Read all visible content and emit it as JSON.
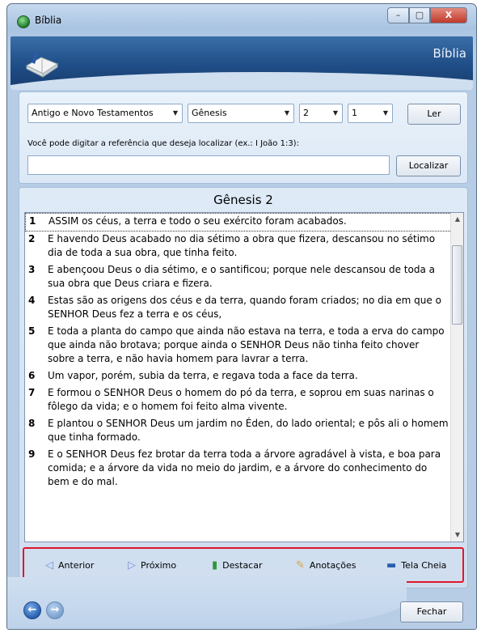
{
  "window": {
    "title": "Bíblia",
    "controls": {
      "minimize": "–",
      "maximize": "▢",
      "close": "X"
    }
  },
  "header": {
    "title": "Bíblia"
  },
  "selectors": {
    "testament": "Antigo e Novo Testamentos",
    "book": "Gênesis",
    "chapter": "2",
    "verse": "1",
    "read_button": "Ler"
  },
  "search": {
    "hint": "Você pode digitar a referência que deseja localizar (ex.: I João 1:3):",
    "value": "",
    "placeholder": "",
    "button": "Localizar"
  },
  "reading": {
    "chapter_title": "Gênesis 2",
    "verses": [
      {
        "num": "1",
        "text": "ASSIM os céus, a terra e todo o seu exército foram acabados."
      },
      {
        "num": "2",
        "text": "E havendo Deus acabado no dia sétimo a obra que fizera, descansou no sétimo dia de toda a sua obra, que tinha feito."
      },
      {
        "num": "3",
        "text": "E abençoou Deus o dia sétimo, e o santificou; porque nele descansou de toda a sua obra que Deus criara e fizera."
      },
      {
        "num": "4",
        "text": "Estas são as origens dos céus e da terra, quando foram criados; no dia em que o SENHOR Deus fez a terra e os céus,"
      },
      {
        "num": "5",
        "text": "E toda a planta do campo que ainda não estava na terra, e toda a erva do campo que ainda não brotava; porque ainda o SENHOR Deus não tinha feito chover sobre a terra, e não havia homem para lavrar a terra."
      },
      {
        "num": "6",
        "text": "Um vapor, porém, subia da terra, e regava toda a face da terra."
      },
      {
        "num": "7",
        "text": "E formou o SENHOR Deus o homem do pó da terra, e soprou em suas narinas o fôlego da vida; e o homem foi feito alma vivente."
      },
      {
        "num": "8",
        "text": "E plantou o SENHOR Deus um jardim no Éden, do lado oriental; e pôs ali o homem que tinha formado."
      },
      {
        "num": "9",
        "text": "E o SENHOR Deus fez brotar da terra toda a árvore agradável à vista, e boa para comida; e a árvore da vida no meio do jardim, e a árvore do conhecimento do bem e do mal."
      }
    ]
  },
  "toolbar": {
    "previous": "Anterior",
    "next": "Próximo",
    "highlight": "Destacar",
    "notes": "Anotações",
    "fullscreen": "Tela Cheia"
  },
  "footer": {
    "close_button": "Fechar"
  },
  "icons": {
    "app": "bible-app-icon",
    "book": "open-book-icon",
    "previous": "triangle-left-icon",
    "next": "triangle-right-icon",
    "highlight": "highlighter-icon",
    "notes": "pencil-icon",
    "fullscreen": "monitor-icon",
    "back": "arrow-left-circle-icon",
    "forward": "arrow-right-circle-icon"
  },
  "colors": {
    "header_blue": "#1f4d86",
    "toolbar_outline": "#e2162b",
    "panel_bg": "#dbe8f6"
  }
}
